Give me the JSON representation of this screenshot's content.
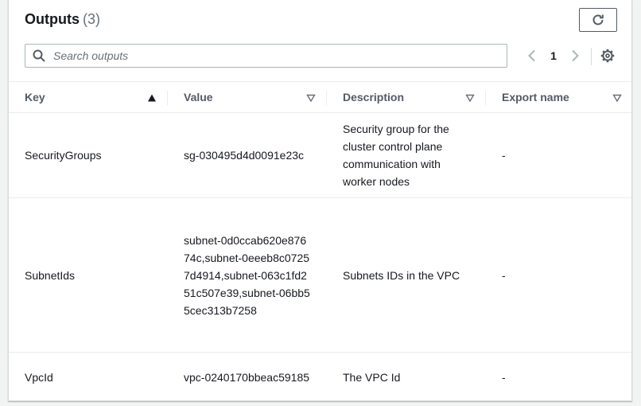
{
  "header": {
    "title": "Outputs",
    "count": "(3)"
  },
  "search": {
    "placeholder": "Search outputs",
    "value": ""
  },
  "pagination": {
    "current_page": "1"
  },
  "table": {
    "columns": [
      "Key",
      "Value",
      "Description",
      "Export name"
    ],
    "rows": [
      {
        "key": "SecurityGroups",
        "value": "sg-030495d4d0091e23c",
        "description": "Security group for the cluster control plane communication with worker nodes",
        "export": "-"
      },
      {
        "key": "SubnetIds",
        "value": "subnet-0d0ccab620e87674c,subnet-0eeeb8c07257d4914,subnet-063c1fd251c507e39,subnet-06bb55cec313b7258",
        "description": "Subnets IDs in the VPC",
        "export": "-"
      },
      {
        "key": "VpcId",
        "value": "vpc-0240170bbeac59185",
        "description": "The VPC Id",
        "export": "-"
      }
    ]
  },
  "icons": {
    "refresh": "refresh-icon",
    "search": "search-icon",
    "prev": "chevron-left-icon",
    "next": "chevron-right-icon",
    "settings": "gear-icon",
    "sort_asc": "sort-ascending-icon",
    "sort": "sort-icon"
  },
  "colors": {
    "text": "#16191f",
    "muted": "#687078",
    "border": "#d5dbdb",
    "background": "#f2f3f3"
  }
}
